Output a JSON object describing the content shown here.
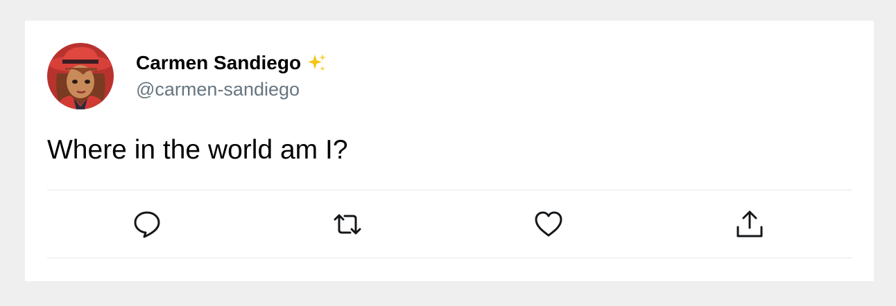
{
  "tweet": {
    "author_name": "Carmen Sandiego",
    "author_handle": "@carmen-sandiego",
    "verified_badge_icon": "sparkles-icon",
    "text": "Where in the world am I?"
  },
  "actions": [
    {
      "icon": "reply-icon"
    },
    {
      "icon": "retweet-icon"
    },
    {
      "icon": "like-icon"
    },
    {
      "icon": "share-icon"
    }
  ],
  "colors": {
    "page_background": "#efefef",
    "card_background": "#ffffff",
    "handle_text": "#66757f",
    "divider": "#e1e5e8",
    "sparkle": "#f5c518"
  }
}
